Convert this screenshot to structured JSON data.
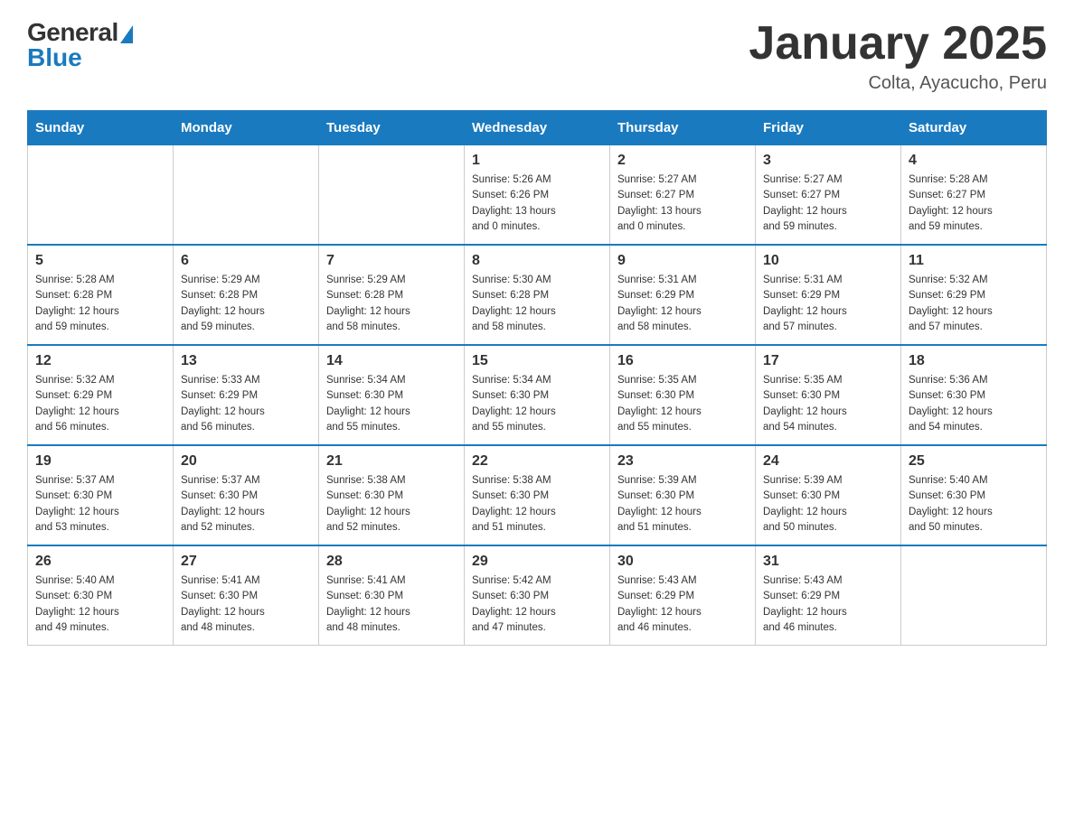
{
  "header": {
    "logo": {
      "general": "General",
      "blue": "Blue"
    },
    "title": "January 2025",
    "location": "Colta, Ayacucho, Peru"
  },
  "calendar": {
    "days_of_week": [
      "Sunday",
      "Monday",
      "Tuesday",
      "Wednesday",
      "Thursday",
      "Friday",
      "Saturday"
    ],
    "weeks": [
      [
        {
          "day": "",
          "info": ""
        },
        {
          "day": "",
          "info": ""
        },
        {
          "day": "",
          "info": ""
        },
        {
          "day": "1",
          "info": "Sunrise: 5:26 AM\nSunset: 6:26 PM\nDaylight: 13 hours\nand 0 minutes."
        },
        {
          "day": "2",
          "info": "Sunrise: 5:27 AM\nSunset: 6:27 PM\nDaylight: 13 hours\nand 0 minutes."
        },
        {
          "day": "3",
          "info": "Sunrise: 5:27 AM\nSunset: 6:27 PM\nDaylight: 12 hours\nand 59 minutes."
        },
        {
          "day": "4",
          "info": "Sunrise: 5:28 AM\nSunset: 6:27 PM\nDaylight: 12 hours\nand 59 minutes."
        }
      ],
      [
        {
          "day": "5",
          "info": "Sunrise: 5:28 AM\nSunset: 6:28 PM\nDaylight: 12 hours\nand 59 minutes."
        },
        {
          "day": "6",
          "info": "Sunrise: 5:29 AM\nSunset: 6:28 PM\nDaylight: 12 hours\nand 59 minutes."
        },
        {
          "day": "7",
          "info": "Sunrise: 5:29 AM\nSunset: 6:28 PM\nDaylight: 12 hours\nand 58 minutes."
        },
        {
          "day": "8",
          "info": "Sunrise: 5:30 AM\nSunset: 6:28 PM\nDaylight: 12 hours\nand 58 minutes."
        },
        {
          "day": "9",
          "info": "Sunrise: 5:31 AM\nSunset: 6:29 PM\nDaylight: 12 hours\nand 58 minutes."
        },
        {
          "day": "10",
          "info": "Sunrise: 5:31 AM\nSunset: 6:29 PM\nDaylight: 12 hours\nand 57 minutes."
        },
        {
          "day": "11",
          "info": "Sunrise: 5:32 AM\nSunset: 6:29 PM\nDaylight: 12 hours\nand 57 minutes."
        }
      ],
      [
        {
          "day": "12",
          "info": "Sunrise: 5:32 AM\nSunset: 6:29 PM\nDaylight: 12 hours\nand 56 minutes."
        },
        {
          "day": "13",
          "info": "Sunrise: 5:33 AM\nSunset: 6:29 PM\nDaylight: 12 hours\nand 56 minutes."
        },
        {
          "day": "14",
          "info": "Sunrise: 5:34 AM\nSunset: 6:30 PM\nDaylight: 12 hours\nand 55 minutes."
        },
        {
          "day": "15",
          "info": "Sunrise: 5:34 AM\nSunset: 6:30 PM\nDaylight: 12 hours\nand 55 minutes."
        },
        {
          "day": "16",
          "info": "Sunrise: 5:35 AM\nSunset: 6:30 PM\nDaylight: 12 hours\nand 55 minutes."
        },
        {
          "day": "17",
          "info": "Sunrise: 5:35 AM\nSunset: 6:30 PM\nDaylight: 12 hours\nand 54 minutes."
        },
        {
          "day": "18",
          "info": "Sunrise: 5:36 AM\nSunset: 6:30 PM\nDaylight: 12 hours\nand 54 minutes."
        }
      ],
      [
        {
          "day": "19",
          "info": "Sunrise: 5:37 AM\nSunset: 6:30 PM\nDaylight: 12 hours\nand 53 minutes."
        },
        {
          "day": "20",
          "info": "Sunrise: 5:37 AM\nSunset: 6:30 PM\nDaylight: 12 hours\nand 52 minutes."
        },
        {
          "day": "21",
          "info": "Sunrise: 5:38 AM\nSunset: 6:30 PM\nDaylight: 12 hours\nand 52 minutes."
        },
        {
          "day": "22",
          "info": "Sunrise: 5:38 AM\nSunset: 6:30 PM\nDaylight: 12 hours\nand 51 minutes."
        },
        {
          "day": "23",
          "info": "Sunrise: 5:39 AM\nSunset: 6:30 PM\nDaylight: 12 hours\nand 51 minutes."
        },
        {
          "day": "24",
          "info": "Sunrise: 5:39 AM\nSunset: 6:30 PM\nDaylight: 12 hours\nand 50 minutes."
        },
        {
          "day": "25",
          "info": "Sunrise: 5:40 AM\nSunset: 6:30 PM\nDaylight: 12 hours\nand 50 minutes."
        }
      ],
      [
        {
          "day": "26",
          "info": "Sunrise: 5:40 AM\nSunset: 6:30 PM\nDaylight: 12 hours\nand 49 minutes."
        },
        {
          "day": "27",
          "info": "Sunrise: 5:41 AM\nSunset: 6:30 PM\nDaylight: 12 hours\nand 48 minutes."
        },
        {
          "day": "28",
          "info": "Sunrise: 5:41 AM\nSunset: 6:30 PM\nDaylight: 12 hours\nand 48 minutes."
        },
        {
          "day": "29",
          "info": "Sunrise: 5:42 AM\nSunset: 6:30 PM\nDaylight: 12 hours\nand 47 minutes."
        },
        {
          "day": "30",
          "info": "Sunrise: 5:43 AM\nSunset: 6:29 PM\nDaylight: 12 hours\nand 46 minutes."
        },
        {
          "day": "31",
          "info": "Sunrise: 5:43 AM\nSunset: 6:29 PM\nDaylight: 12 hours\nand 46 minutes."
        },
        {
          "day": "",
          "info": ""
        }
      ]
    ]
  }
}
